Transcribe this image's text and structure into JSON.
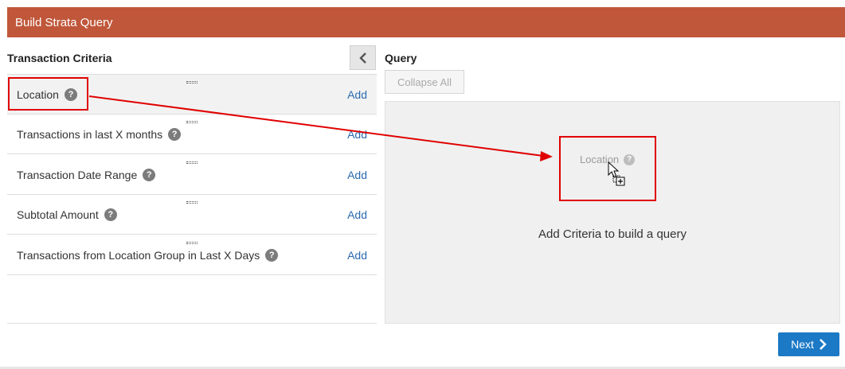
{
  "header": {
    "title": "Build Strata Query"
  },
  "left_panel": {
    "title": "Transaction Criteria",
    "collapse_icon": "chevron-left-icon",
    "criteria": [
      {
        "label": "Location",
        "add_label": "Add",
        "help_icon": "question-icon"
      },
      {
        "label": "Transactions in last X months",
        "add_label": "Add",
        "help_icon": "question-icon"
      },
      {
        "label": "Transaction Date Range",
        "add_label": "Add",
        "help_icon": "question-icon"
      },
      {
        "label": "Subtotal Amount",
        "add_label": "Add",
        "help_icon": "question-icon"
      },
      {
        "label": "Transactions from Location Group in Last X Days",
        "add_label": "Add",
        "help_icon": "question-icon"
      }
    ]
  },
  "right_panel": {
    "title": "Query",
    "collapse_all_label": "Collapse All",
    "drag_ghost_label": "Location",
    "empty_hint": "Add Criteria to build a query"
  },
  "footer": {
    "next_label": "Next"
  },
  "colors": {
    "header_bg": "#c0573a",
    "link": "#2a6ab0",
    "primary_button": "#1b79c6",
    "annotation": "#e00000"
  }
}
